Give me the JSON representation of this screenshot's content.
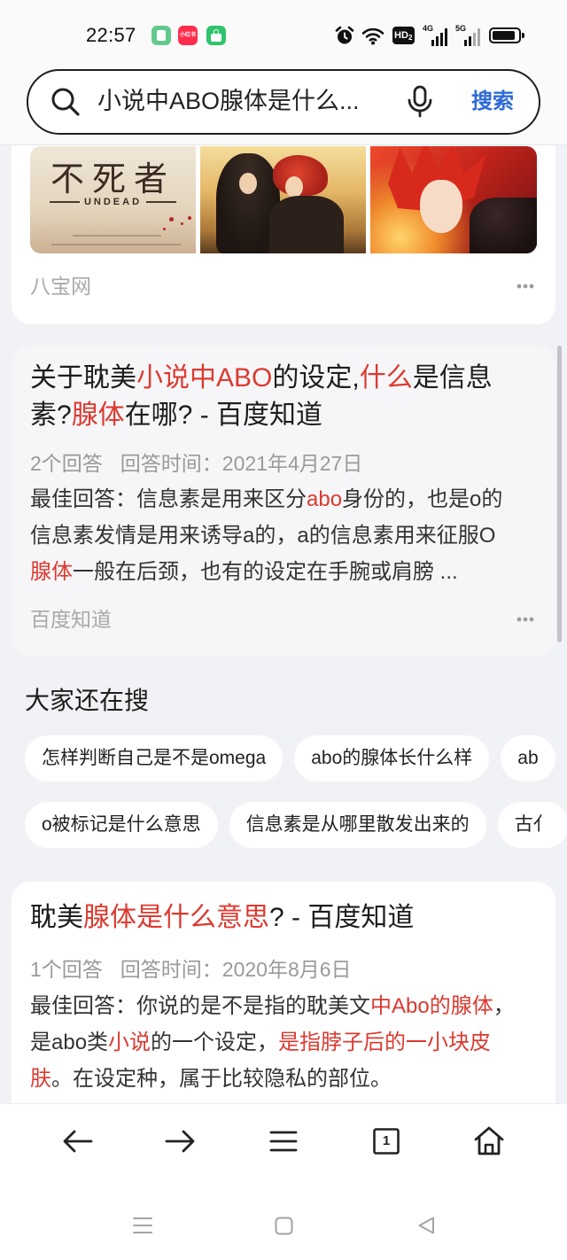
{
  "theme": {
    "page_bg": "#f1f2f5",
    "highlight_red": "#dc3a30",
    "accent_blue": "#2d6ad8",
    "text_primary": "#222222",
    "text_meta": "#9a9a9a"
  },
  "status_bar": {
    "time": "22:57",
    "apps": [
      {
        "icon": "notes-app-icon",
        "color": "#62c98e"
      },
      {
        "icon": "xiaohongshu-app-icon",
        "label": "小红书",
        "color": "#ff2d4b"
      },
      {
        "icon": "shopping-bag-app-icon",
        "color": "#2ec36d"
      }
    ],
    "indicators": [
      "alarm-icon",
      "wifi-icon",
      "hd-voice-icon",
      "signal-4g-icon",
      "signal-5g-icon",
      "battery-icon"
    ],
    "hd_label": "HD",
    "hd_sim": "2",
    "signal_1_label": "4G",
    "signal_2_label": "5G",
    "battery_level": 0.9
  },
  "search": {
    "query": "小说中ABO腺体是什么...",
    "submit_label": "搜索"
  },
  "image_result": {
    "poster_title": "不死者",
    "poster_subtitle": "UNDEAD",
    "source": "八宝网"
  },
  "qa_result_1": {
    "title_lines": [
      [
        {
          "t": "关于耽美"
        },
        {
          "t": "小说中ABO",
          "hl": true
        },
        {
          "t": "的设定,"
        },
        {
          "t": "什么",
          "hl": true
        },
        {
          "t": "是信息"
        }
      ],
      [
        {
          "t": "素?"
        },
        {
          "t": "腺体",
          "hl": true
        },
        {
          "t": "在哪? - 百度知道"
        }
      ]
    ],
    "answer_count": "2个回答",
    "answer_time": "回答时间：2021年4月27日",
    "snippet_lines": [
      [
        {
          "t": "最佳回答：信息素是用来区分"
        },
        {
          "t": "abo",
          "hl": true
        },
        {
          "t": "身份的，也是o的"
        }
      ],
      [
        {
          "t": "信息素发情是用来诱导a的，a的信息素用来征服O"
        }
      ],
      [
        {
          "t": "腺体",
          "hl": true
        },
        {
          "t": "一般在后颈，也有的设定在手腕或肩膀 ..."
        }
      ]
    ],
    "source": "百度知道"
  },
  "related_searches": {
    "heading": "大家还在搜",
    "row_1": [
      "怎样判断自己是不是omega",
      "abo的腺体长什么样",
      "ab"
    ],
    "row_2": [
      "o被标记是什么意思",
      "信息素是从哪里散发出来的",
      "古亻"
    ]
  },
  "qa_result_2": {
    "title_lines": [
      [
        {
          "t": "耽美"
        },
        {
          "t": "腺体是什么意思",
          "hl": true
        },
        {
          "t": "? - 百度知道"
        }
      ]
    ],
    "answer_count": "1个回答",
    "answer_time": "回答时间：2020年8月6日",
    "snippet_lines": [
      [
        {
          "t": "最佳回答：你说的是不是指的耽美文"
        },
        {
          "t": "中Abo的腺体",
          "hl": true
        },
        {
          "t": "，"
        }
      ],
      [
        {
          "t": "是abo类"
        },
        {
          "t": "小说",
          "hl": true
        },
        {
          "t": "的一个设定，"
        },
        {
          "t": "是指脖子后的一小块皮",
          "hl": true
        }
      ],
      [
        {
          "t": "肤",
          "hl": true
        },
        {
          "t": "。在设定种，属于比较隐私的部位。"
        }
      ]
    ]
  },
  "toolbar": {
    "icons": [
      "back-arrow-icon",
      "forward-arrow-icon",
      "menu-icon",
      "tabs-icon",
      "home-icon"
    ],
    "tab_count": "1"
  },
  "system_nav": {
    "icons": [
      "recent-apps-icon",
      "home-square-icon",
      "back-triangle-icon"
    ]
  }
}
